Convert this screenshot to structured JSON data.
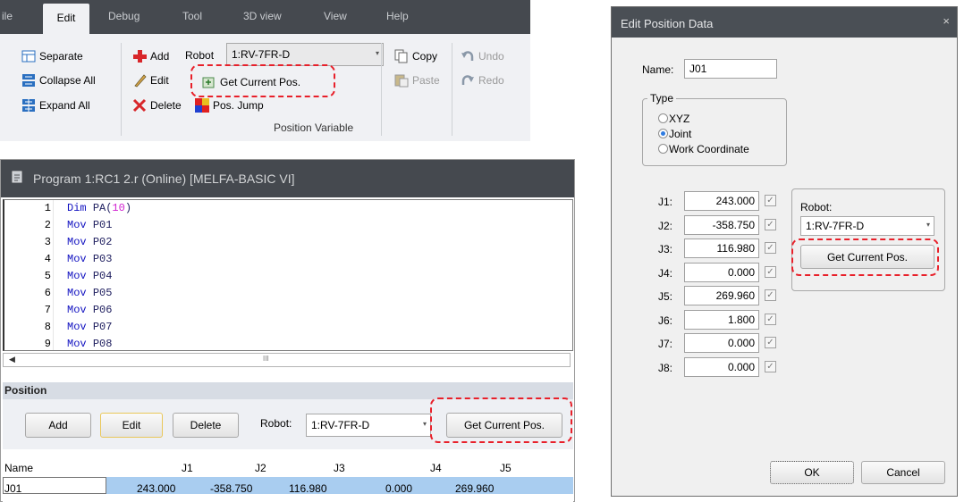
{
  "ribbon": {
    "tabs": [
      "ile",
      "Edit",
      "Debug",
      "Tool",
      "3D view",
      "View",
      "Help"
    ],
    "active_tab": "Edit",
    "separate": "Separate",
    "collapse_all": "Collapse All",
    "expand_all": "Expand All",
    "add": "Add",
    "edit": "Edit",
    "delete": "Delete",
    "robot_label": "Robot",
    "robot_value": "1:RV-7FR-D",
    "get_current_pos": "Get Current Pos.",
    "pos_jump": "Pos. Jump",
    "copy": "Copy",
    "paste": "Paste",
    "undo": "Undo",
    "redo": "Redo",
    "group_label": "Position Variable"
  },
  "editor": {
    "title": "Program 1:RC1 2.r (Online)   [MELFA-BASIC VI]",
    "lines": [
      {
        "n": "1",
        "kw": "Dim",
        "arg": "PA(",
        "num": "10",
        "end": ")"
      },
      {
        "n": "2",
        "kw": "Mov",
        "arg": "P01",
        "num": "",
        "end": ""
      },
      {
        "n": "3",
        "kw": "Mov",
        "arg": "P02",
        "num": "",
        "end": ""
      },
      {
        "n": "4",
        "kw": "Mov",
        "arg": "P03",
        "num": "",
        "end": ""
      },
      {
        "n": "5",
        "kw": "Mov",
        "arg": "P04",
        "num": "",
        "end": ""
      },
      {
        "n": "6",
        "kw": "Mov",
        "arg": "P05",
        "num": "",
        "end": ""
      },
      {
        "n": "7",
        "kw": "Mov",
        "arg": "P06",
        "num": "",
        "end": ""
      },
      {
        "n": "8",
        "kw": "Mov",
        "arg": "P07",
        "num": "",
        "end": ""
      },
      {
        "n": "9",
        "kw": "Mov",
        "arg": "P08",
        "num": "",
        "end": ""
      }
    ],
    "scroll_mark": "III"
  },
  "position_panel": {
    "header": "Position",
    "add": "Add",
    "edit": "Edit",
    "delete": "Delete",
    "robot_label": "Robot:",
    "robot_value": "1:RV-7FR-D",
    "get_current_pos": "Get Current Pos.",
    "columns": [
      "Name",
      "J1",
      "J2",
      "J3",
      "J4",
      "J5"
    ],
    "row": [
      "J01",
      "243.000",
      "-358.750",
      "116.980",
      "0.000",
      "269.960"
    ]
  },
  "dialog": {
    "title": "Edit Position Data",
    "close": "×",
    "name_label": "Name:",
    "name_value": "J01",
    "type_label": "Type",
    "types": [
      "XYZ",
      "Joint",
      "Work Coordinate"
    ],
    "selected_type": "Joint",
    "joints": [
      {
        "label": "J1:",
        "value": "243.000"
      },
      {
        "label": "J2:",
        "value": "-358.750"
      },
      {
        "label": "J3:",
        "value": "116.980"
      },
      {
        "label": "J4:",
        "value": "0.000"
      },
      {
        "label": "J5:",
        "value": "269.960"
      },
      {
        "label": "J6:",
        "value": "1.800"
      },
      {
        "label": "J7:",
        "value": "0.000"
      },
      {
        "label": "J8:",
        "value": "0.000"
      }
    ],
    "robot_label": "Robot:",
    "robot_value": "1:RV-7FR-D",
    "get_current_pos": "Get Current Pos.",
    "ok": "OK",
    "cancel": "Cancel"
  },
  "colors": {
    "highlight_dash": "#e8202a",
    "dark_bar": "#45494f",
    "selection": "#a9cdf0"
  }
}
